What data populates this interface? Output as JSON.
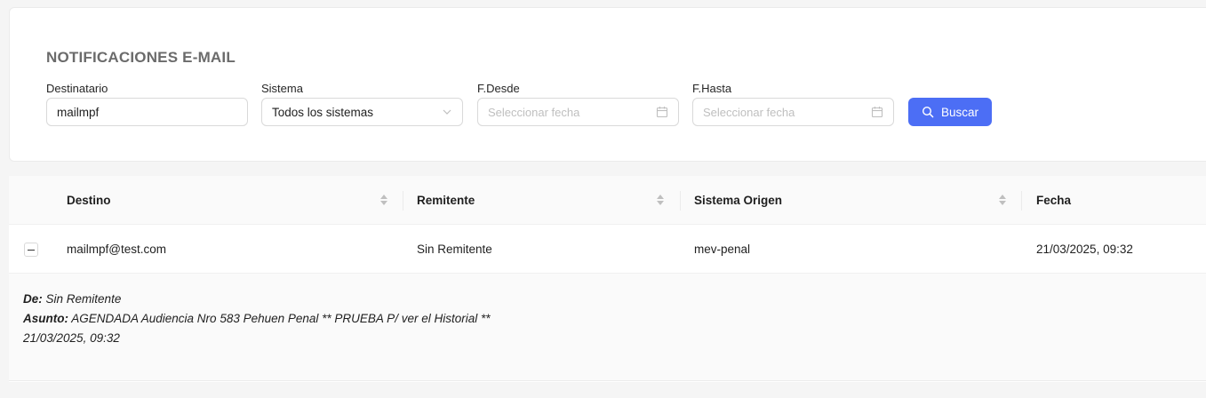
{
  "filters": {
    "title": "NOTIFICACIONES E-MAIL",
    "destinatario": {
      "label": "Destinatario",
      "value": "mailmpf"
    },
    "sistema": {
      "label": "Sistema",
      "value": "Todos los sistemas"
    },
    "desde": {
      "label": "F.Desde",
      "placeholder": "Seleccionar fecha"
    },
    "hasta": {
      "label": "F.Hasta",
      "placeholder": "Seleccionar fecha"
    },
    "search_button": "Buscar"
  },
  "table": {
    "columns": [
      "Destino",
      "Remitente",
      "Sistema Origen",
      "Fecha"
    ],
    "rows": [
      {
        "destino": "mailmpf@test.com",
        "remitente": "Sin Remitente",
        "sistema": "mev-penal",
        "fecha": "21/03/2025, 09:32",
        "expanded": true,
        "detail": {
          "de_label": "De:",
          "de_value": "Sin Remitente",
          "asunto_label": "Asunto:",
          "asunto_value": "AGENDADA Audiencia Nro 583 Pehuen Penal ** PRUEBA P/ ver el Historial **",
          "fecha": "21/03/2025, 09:32"
        }
      }
    ]
  },
  "icons": {
    "search": "search-icon",
    "calendar": "calendar-icon",
    "chevron": "chevron-down-icon",
    "sorter": "sort-icon",
    "collapse": "minus-icon"
  },
  "colors": {
    "primary": "#4c6ef5",
    "title": "#6b6b6b",
    "header_bg": "#fafafa"
  }
}
